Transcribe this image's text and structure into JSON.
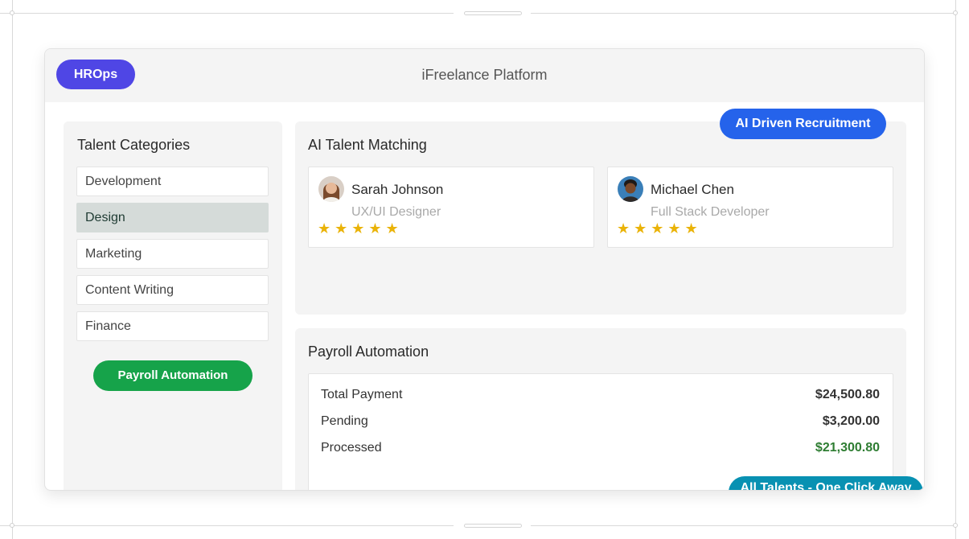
{
  "window": {
    "title": "iFreelance Platform",
    "brand": "HROps"
  },
  "sidebar": {
    "heading": "Talent Categories",
    "categories": [
      {
        "label": "Development",
        "active": false
      },
      {
        "label": "Design",
        "active": true
      },
      {
        "label": "Marketing",
        "active": false
      },
      {
        "label": "Content Writing",
        "active": false
      },
      {
        "label": "Finance",
        "active": false
      }
    ],
    "action_label": "Payroll Automation"
  },
  "matching": {
    "heading": "AI Talent Matching",
    "badge": "AI Driven Recruitment",
    "candidates": [
      {
        "name": "Sarah Johnson",
        "role": "UX/UI Designer",
        "rating": 5,
        "stars": "★★★★★"
      },
      {
        "name": "Michael Chen",
        "role": "Full Stack Developer",
        "rating": 5,
        "stars": "★★★★★"
      }
    ]
  },
  "payroll": {
    "heading": "Payroll Automation",
    "rows": [
      {
        "label": "Total Payment",
        "value": "$24,500.80"
      },
      {
        "label": "Pending",
        "value": "$3,200.00"
      },
      {
        "label": "Processed",
        "value": "$21,300.80"
      }
    ]
  },
  "footer_badge": "All Talents - One Click Away",
  "colors": {
    "brand": "#4f46e5",
    "ai_badge": "#2563eb",
    "payroll_button": "#16a34a",
    "footer_badge": "#0891b2",
    "processed_value": "#2e7d32",
    "active_category": "#d5dbd9",
    "star": "#eab308"
  }
}
